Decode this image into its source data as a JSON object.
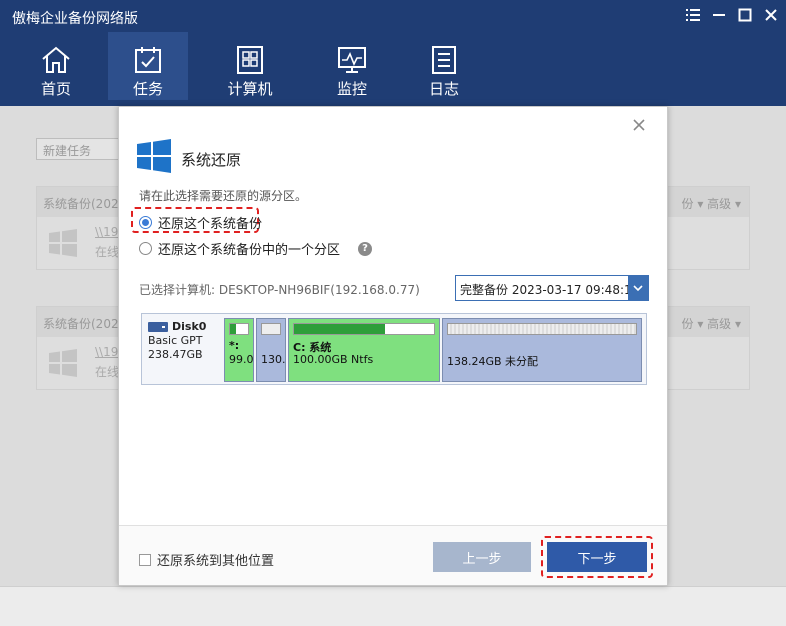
{
  "titlebar": {
    "title": "傲梅企业备份网络版",
    "controls": [
      {
        "name": "menu-icon"
      },
      {
        "name": "minimize-icon"
      },
      {
        "name": "maximize-icon"
      },
      {
        "name": "close-icon"
      }
    ]
  },
  "nav": {
    "items": [
      {
        "label": "首页",
        "icon": "home-icon"
      },
      {
        "label": "任务",
        "icon": "task-icon",
        "active": true
      },
      {
        "label": "计算机",
        "icon": "computer-icon"
      },
      {
        "label": "监控",
        "icon": "monitor-icon"
      },
      {
        "label": "日志",
        "icon": "log-icon"
      }
    ]
  },
  "background": {
    "new_task": "新建任务",
    "panels": [
      {
        "header": "系统备份(202",
        "right": "份 ▾   高级 ▾",
        "line1": "\\\\19",
        "line2": "在线"
      },
      {
        "header": "系统备份(202",
        "right": "份 ▾   高级 ▾",
        "line1": "\\\\19",
        "line2": "在线"
      }
    ]
  },
  "dialog": {
    "title": "系统还原",
    "subtitle": "请在此选择需要还原的源分区。",
    "options": [
      {
        "label": "还原这个系统备份",
        "checked": true
      },
      {
        "label": "还原这个系统备份中的一个分区",
        "checked": false
      }
    ],
    "help": "?",
    "selected_computer": "已选择计算机: DESKTOP-NH96BIF(192.168.0.77)",
    "backup_select": "完整备份  2023-03-17 09:48:18",
    "disk": {
      "name": "Disk0",
      "type": "Basic GPT",
      "size": "238.47GB",
      "partitions": [
        {
          "l1": "*:",
          "l2": "99.0",
          "fill": 0.35,
          "color": "#7fe07f",
          "bar_color": "#2e9e3a"
        },
        {
          "l1": "",
          "l2": "130.",
          "fill": 0.0,
          "color": "#aab9dc",
          "bar_color": "#cccccc"
        },
        {
          "l1": "C: 系统",
          "l2": "100.00GB Ntfs",
          "fill": 0.65,
          "color": "#7fe07f",
          "bar_color": "#2e9e3a"
        },
        {
          "l1": "",
          "l2": "138.24GB 未分配",
          "fill": 0.0,
          "color": "#aab9dc",
          "bar_color": "#dddddd"
        }
      ]
    },
    "restore_other": "还原系统到其他位置",
    "prev": "上一步",
    "next": "下一步",
    "accent": "#2f5aa8",
    "highlight": "#e02020"
  }
}
